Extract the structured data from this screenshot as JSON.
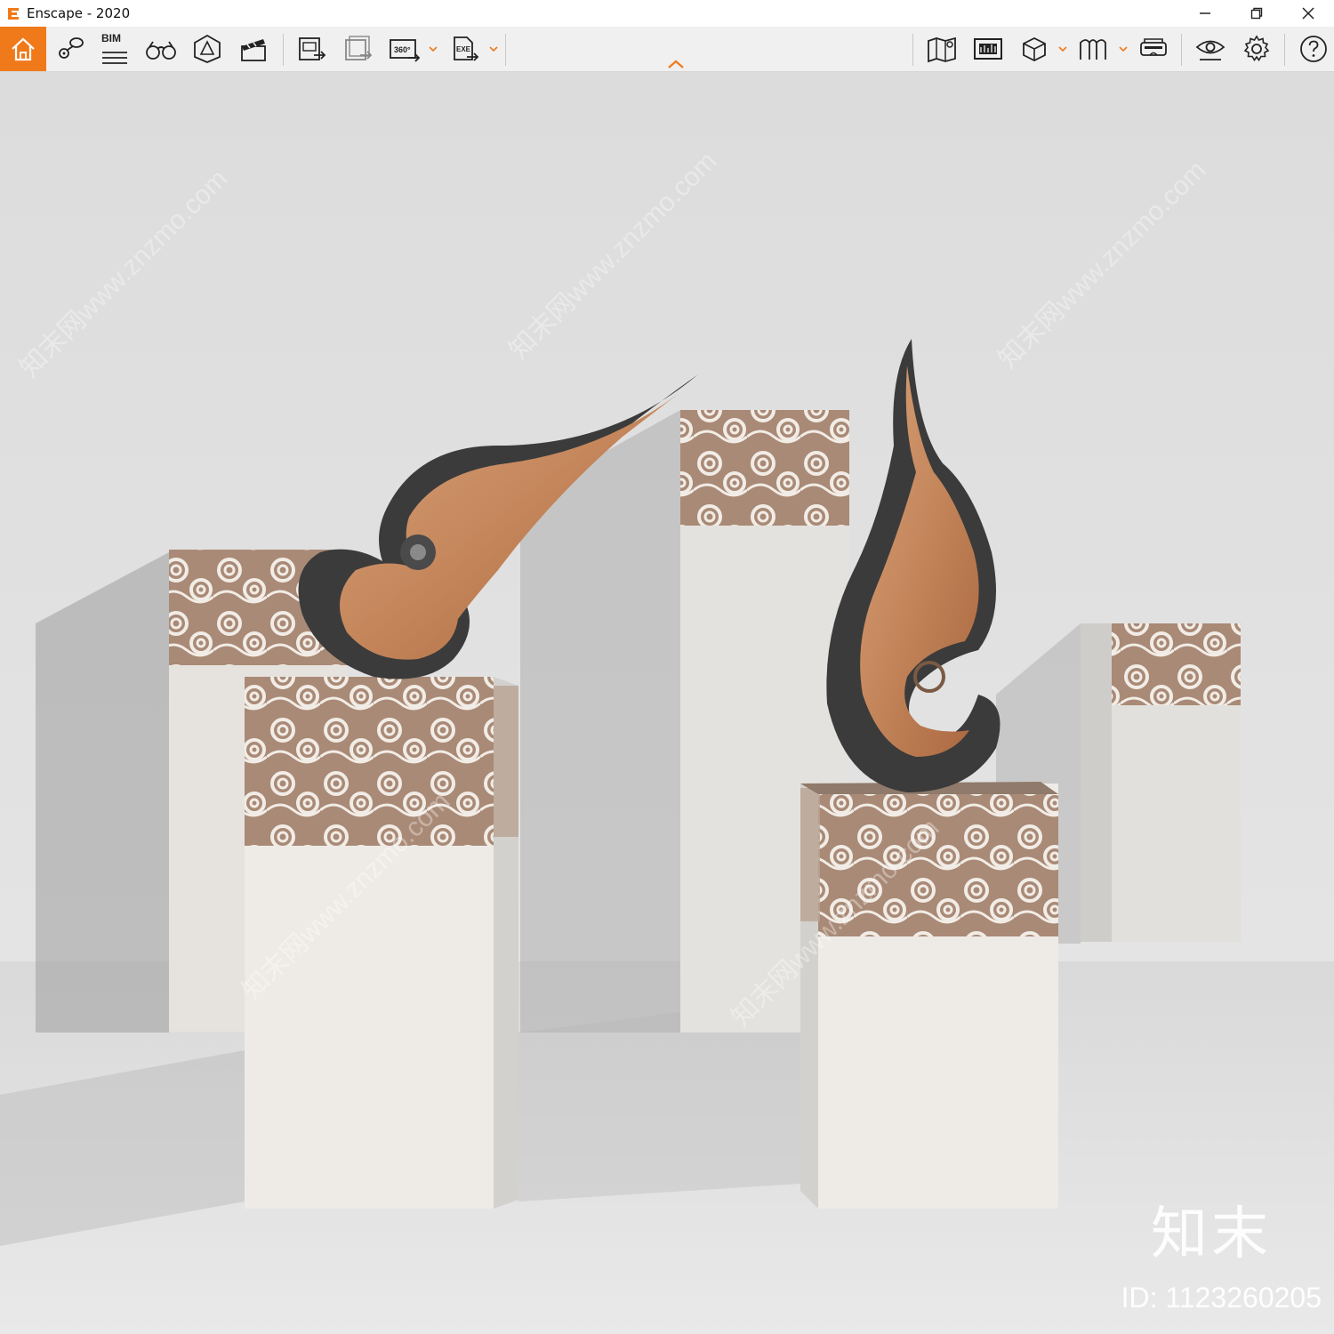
{
  "window": {
    "title": "Enscape - 2020",
    "controls": [
      "minimize-icon",
      "restore-icon",
      "close-icon"
    ]
  },
  "toolbar": {
    "accent_color": "#f07a1a",
    "bim_label": "BIM",
    "left_icons": [
      "home-icon",
      "view-management-icon",
      "bim-icon",
      "binoculars-icon",
      "asset-library-icon",
      "video-editor-icon",
      "render-screenshot-icon",
      "batch-render-icon",
      "panorama-360-icon",
      "export-exe-icon"
    ],
    "panorama_label": "360°",
    "exe_label": "EXE",
    "right_icons": [
      "map-icon",
      "visual-settings-icon",
      "cube-icon",
      "material-editor-icon",
      "vr-headset-icon",
      "view-settings-icon",
      "settings-gear-icon",
      "help-icon"
    ]
  },
  "viewport": {
    "watermark_logo": "知末",
    "watermark_id": "ID: 1123260205",
    "watermark_diagonal": "知末网www.znzmo.com"
  }
}
